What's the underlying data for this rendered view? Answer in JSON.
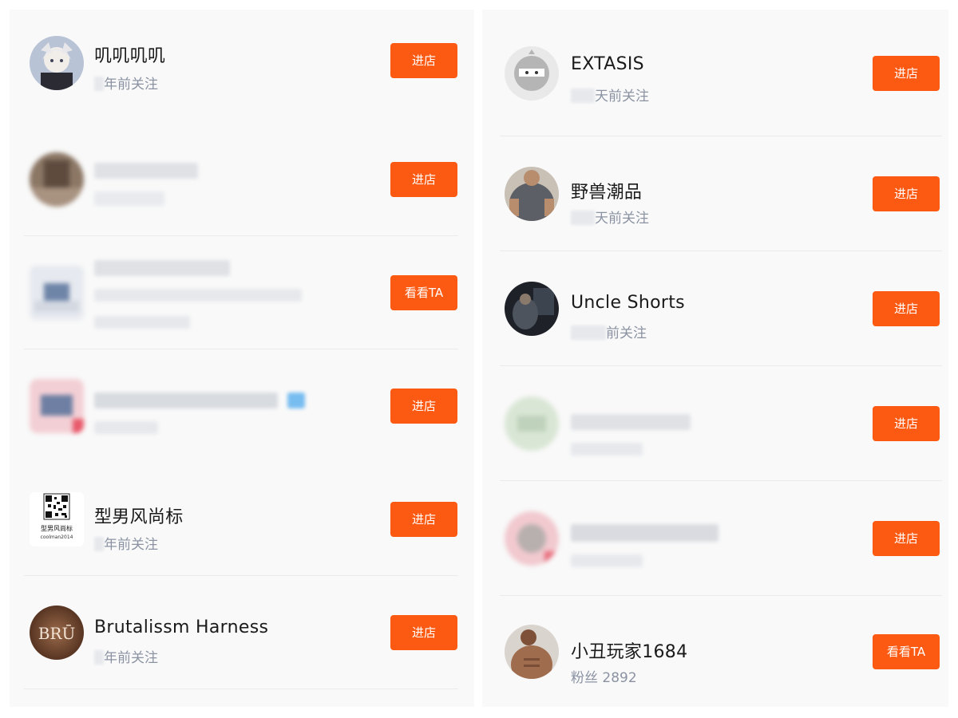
{
  "left": [
    {
      "name": "叽叽叽叽",
      "subtitle": "年前关注",
      "button": "进店",
      "blurred": false
    },
    {
      "name": "",
      "subtitle": "",
      "button": "进店",
      "blurred": true
    },
    {
      "name": "",
      "subtitle": "",
      "button": "看看TA",
      "blurred": true
    },
    {
      "name": "",
      "subtitle": "",
      "button": "进店",
      "blurred": true
    },
    {
      "name": "型男风尚标",
      "subtitle": "年前关注",
      "button": "进店",
      "blurred": false,
      "avatar_caption": "型男风尚标",
      "avatar_subcaption": "coolman2014"
    },
    {
      "name": "Brutalissm Harness",
      "subtitle": "年前关注",
      "button": "进店",
      "blurred": false,
      "avatar_text": "BRŪ"
    }
  ],
  "right": [
    {
      "name": "EXTASIS",
      "subtitle": "天前关注",
      "button": "进店",
      "blurred": false
    },
    {
      "name": "野兽潮品",
      "subtitle": "天前关注",
      "button": "进店",
      "blurred": false
    },
    {
      "name": "Uncle Shorts",
      "subtitle": "前关注",
      "button": "进店",
      "blurred": false
    },
    {
      "name": "",
      "subtitle": "",
      "button": "进店",
      "blurred": true
    },
    {
      "name": "",
      "subtitle": "",
      "button": "进店",
      "blurred": true
    },
    {
      "name": "小丑玩家1684",
      "subtitle": "粉丝 2892",
      "button": "看看TA",
      "blurred": false
    }
  ],
  "colors": {
    "accent": "#fc5a12",
    "subtitle": "#8b93a3",
    "panel_bg": "#f9f9f9"
  }
}
